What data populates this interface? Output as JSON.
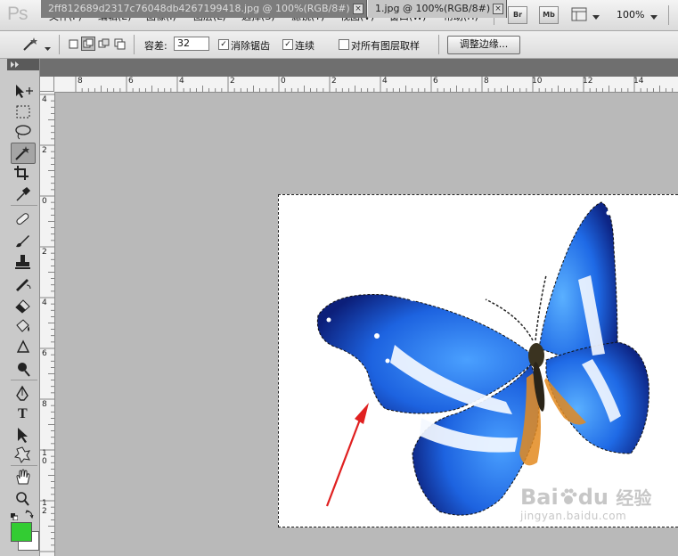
{
  "app": {
    "logo": "Ps"
  },
  "menu": [
    "文件(F)",
    "编辑(E)",
    "图像(I)",
    "图层(L)",
    "选择(S)",
    "滤镜(T)",
    "视图(V)",
    "窗口(W)",
    "帮助(H)"
  ],
  "menubar_buttons": {
    "bridge": "Br",
    "mini_bridge": "Mb"
  },
  "zoom": "100%",
  "options": {
    "tolerance_label": "容差:",
    "tolerance_value": "32",
    "antialias_label": "消除锯齿",
    "antialias_checked": "✓",
    "contiguous_label": "连续",
    "contiguous_checked": "✓",
    "sample_all_label": "对所有图层取样",
    "refine_edge": "调整边缘..."
  },
  "tabs": [
    {
      "title": "2ff812689d2317c76048db4267199418.jpg @ 100%(RGB/8#)",
      "close": "×"
    },
    {
      "title": "1.jpg @ 100%(RGB/8#)",
      "close": "×"
    }
  ],
  "ruler_h": [
    "8",
    "6",
    "4",
    "2",
    "0",
    "2",
    "4",
    "6",
    "8",
    "10",
    "12",
    "14"
  ],
  "ruler_v": [
    "4",
    "2",
    "0",
    "2",
    "4",
    "6",
    "8",
    "1 0",
    "1 2"
  ],
  "watermark": {
    "brand": "Bai",
    "brand2": "du",
    "cn": "经验",
    "url": "jingyan.baidu.com"
  },
  "colors": {
    "foreground": "#33cc33",
    "background": "#ffffff",
    "accent": "#1a5fd6"
  },
  "tools": [
    "move-icon",
    "marquee-icon",
    "lasso-icon",
    "magic-wand-icon",
    "crop-icon",
    "eyedropper-icon",
    "healing-icon",
    "brush-icon",
    "stamp-icon",
    "history-brush-icon",
    "eraser-icon",
    "bucket-icon",
    "blur-icon",
    "dodge-icon",
    "pen-icon",
    "type-icon",
    "path-select-icon",
    "shape-icon",
    "hand-icon",
    "zoom-icon"
  ]
}
